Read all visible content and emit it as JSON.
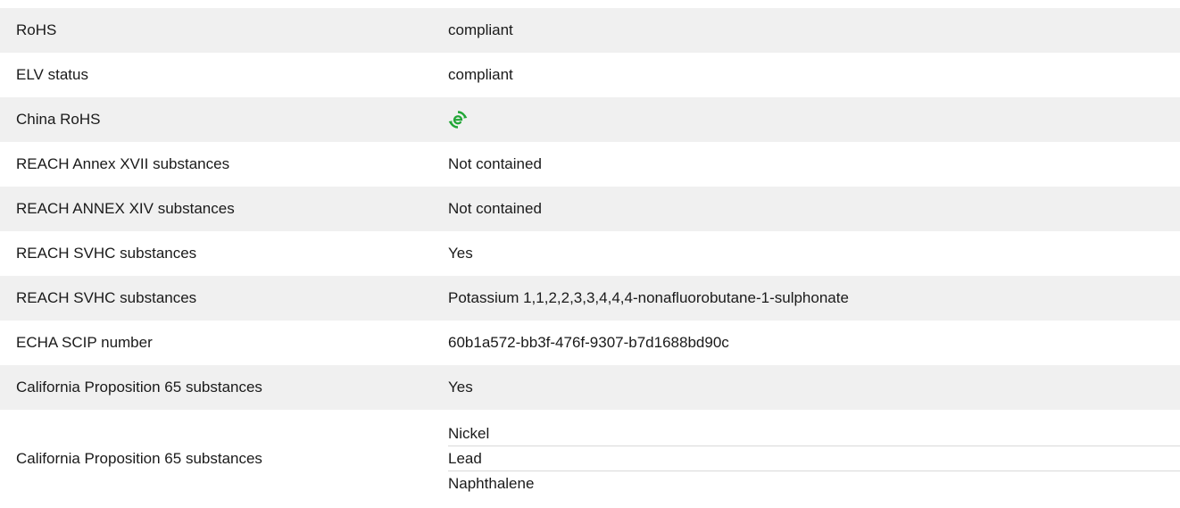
{
  "rows": [
    {
      "label": "RoHS",
      "value": "compliant"
    },
    {
      "label": "ELV status",
      "value": "compliant"
    },
    {
      "label": "China RoHS",
      "icon": "china-rohs-eco-icon",
      "icon_color": "#21a636"
    },
    {
      "label": "REACH Annex XVII substances",
      "value": "Not contained"
    },
    {
      "label": "REACH ANNEX XIV substances",
      "value": "Not contained"
    },
    {
      "label": "REACH SVHC substances",
      "value": "Yes"
    },
    {
      "label": "REACH SVHC substances",
      "value": "Potassium 1,1,2,2,3,3,4,4,4-nonafluorobutane-1-sulphonate"
    },
    {
      "label": "ECHA SCIP number",
      "value": "60b1a572-bb3f-476f-9307-b7d1688bd90c"
    },
    {
      "label": "California Proposition 65 substances",
      "value": "Yes"
    },
    {
      "label": "California Proposition 65 substances",
      "values": [
        "Nickel",
        "Lead",
        "Naphthalene"
      ]
    }
  ],
  "colors": {
    "row_shade": "#f0f0f0",
    "text": "#1a1a1a",
    "eco_green": "#21a636",
    "divider": "#d9d9d9"
  }
}
